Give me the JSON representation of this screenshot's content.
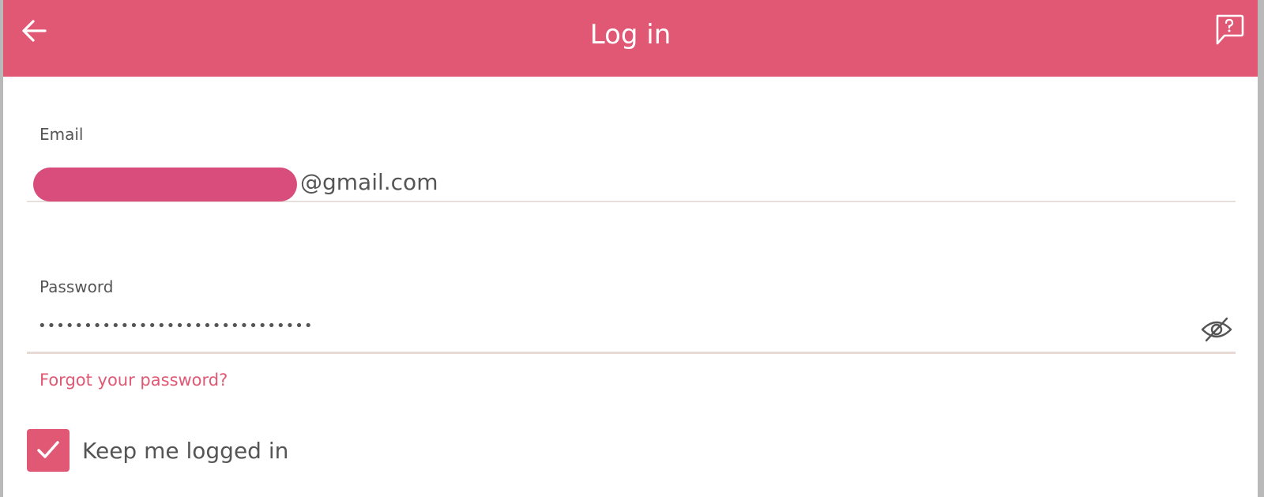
{
  "header": {
    "title": "Log in",
    "back_icon": "back-arrow-icon",
    "help_icon": "help-chat-icon",
    "color": "#e05873"
  },
  "email": {
    "label": "Email",
    "value_suffix": "@gmail.com",
    "mask_color": "#d84d7b"
  },
  "password": {
    "label": "Password",
    "value": "••••••••••••••••••••••••••••••",
    "toggle_icon": "eye-off-icon"
  },
  "forgot_link": "Forgot your password?",
  "keep_logged_in": {
    "label": "Keep me logged in",
    "checked": true,
    "icon": "checkmark-icon"
  }
}
